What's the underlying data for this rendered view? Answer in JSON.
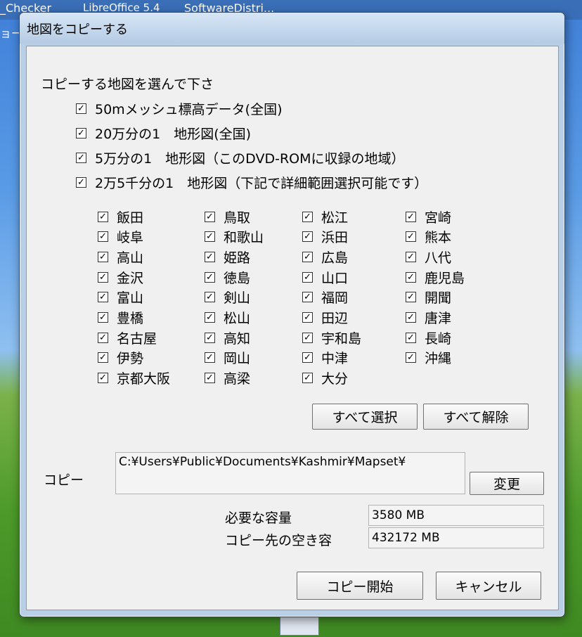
{
  "desktop": {
    "taskbar_items": [
      "_Checker",
      "LibreOffice 5.4",
      "SoftwareDistri..."
    ],
    "left_fragment": "ョー"
  },
  "dialog": {
    "title": "地図をコピーする",
    "instruction": "コピーする地図を選んで下さ",
    "map_types": [
      {
        "label": "50mメッシュ標高データ(全国)",
        "checked": true
      },
      {
        "label": "20万分の1　地形図(全国)",
        "checked": true
      },
      {
        "label": "5万分の1　地形図（このDVD-ROMに収録の地域）",
        "checked": true
      },
      {
        "label": "2万5千分の1　地形図（下記で詳細範囲選択可能です）",
        "checked": true
      }
    ],
    "regions": [
      [
        "飯田",
        "岐阜",
        "高山",
        "金沢",
        "富山",
        "豊橋",
        "名古屋",
        "伊勢",
        "京都大阪"
      ],
      [
        "鳥取",
        "和歌山",
        "姫路",
        "徳島",
        "剣山",
        "松山",
        "高知",
        "岡山",
        "高梁"
      ],
      [
        "松江",
        "浜田",
        "広島",
        "山口",
        "福岡",
        "田辺",
        "宇和島",
        "中津",
        "大分"
      ],
      [
        "宮崎",
        "熊本",
        "八代",
        "鹿児島",
        "開聞",
        "唐津",
        "長崎",
        "沖縄"
      ]
    ],
    "check_glyph": "✓",
    "select_all_label": "すべて選択",
    "deselect_all_label": "すべて解除",
    "copy_label": "コピー",
    "copy_path": "C:¥Users¥Public¥Documents¥Kashmir¥Mapset¥",
    "change_label": "変更",
    "required_label": "必要な容量",
    "required_value": "3580 MB",
    "free_label": "コピー先の空き容",
    "free_value": "432172 MB",
    "start_copy_label": "コピー開始",
    "cancel_label": "キャンセル"
  }
}
